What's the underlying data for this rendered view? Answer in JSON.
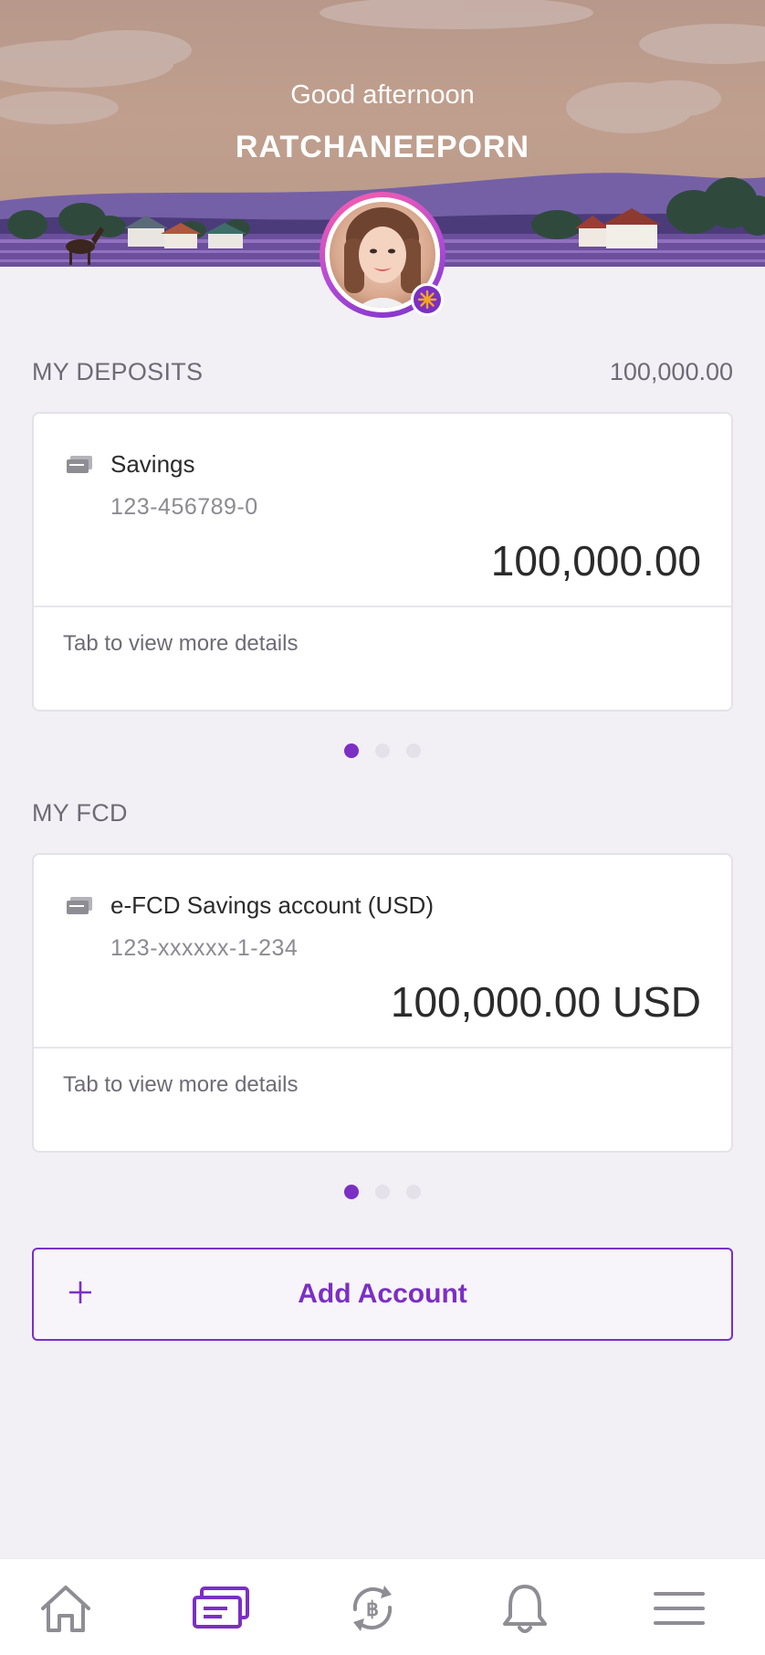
{
  "header": {
    "greeting": "Good afternoon",
    "username": "RATCHANEEPORN"
  },
  "deposits": {
    "title": "MY DEPOSITS",
    "total": "100,000.00",
    "card": {
      "account_name": "Savings",
      "account_number": "123-456789-0",
      "balance": "100,000.00",
      "details_text": "Tab to view more details",
      "icon": "account-card-icon"
    },
    "pager": {
      "count": 3,
      "active": 0
    }
  },
  "fcd": {
    "title": "MY FCD",
    "card": {
      "account_name": "e-FCD Savings account (USD)",
      "account_number": "123-xxxxxx-1-234",
      "balance": "100,000.00 USD",
      "details_text": "Tab to view more details",
      "icon": "account-card-icon"
    },
    "pager": {
      "count": 3,
      "active": 0
    }
  },
  "add_account": {
    "label": "Add Account",
    "icon": "plus-icon"
  },
  "bottom_nav": {
    "items": [
      {
        "icon": "home-icon",
        "active": false
      },
      {
        "icon": "accounts-icon",
        "active": true
      },
      {
        "icon": "transfer-icon",
        "active": false
      },
      {
        "icon": "bell-icon",
        "active": false
      },
      {
        "icon": "menu-icon",
        "active": false
      }
    ]
  },
  "colors": {
    "accent": "#7b2fc4",
    "background": "#f2f0f5",
    "text_primary": "#2b2b2b",
    "text_secondary": "#6e6b75",
    "nav_inactive": "#8f8d94"
  }
}
